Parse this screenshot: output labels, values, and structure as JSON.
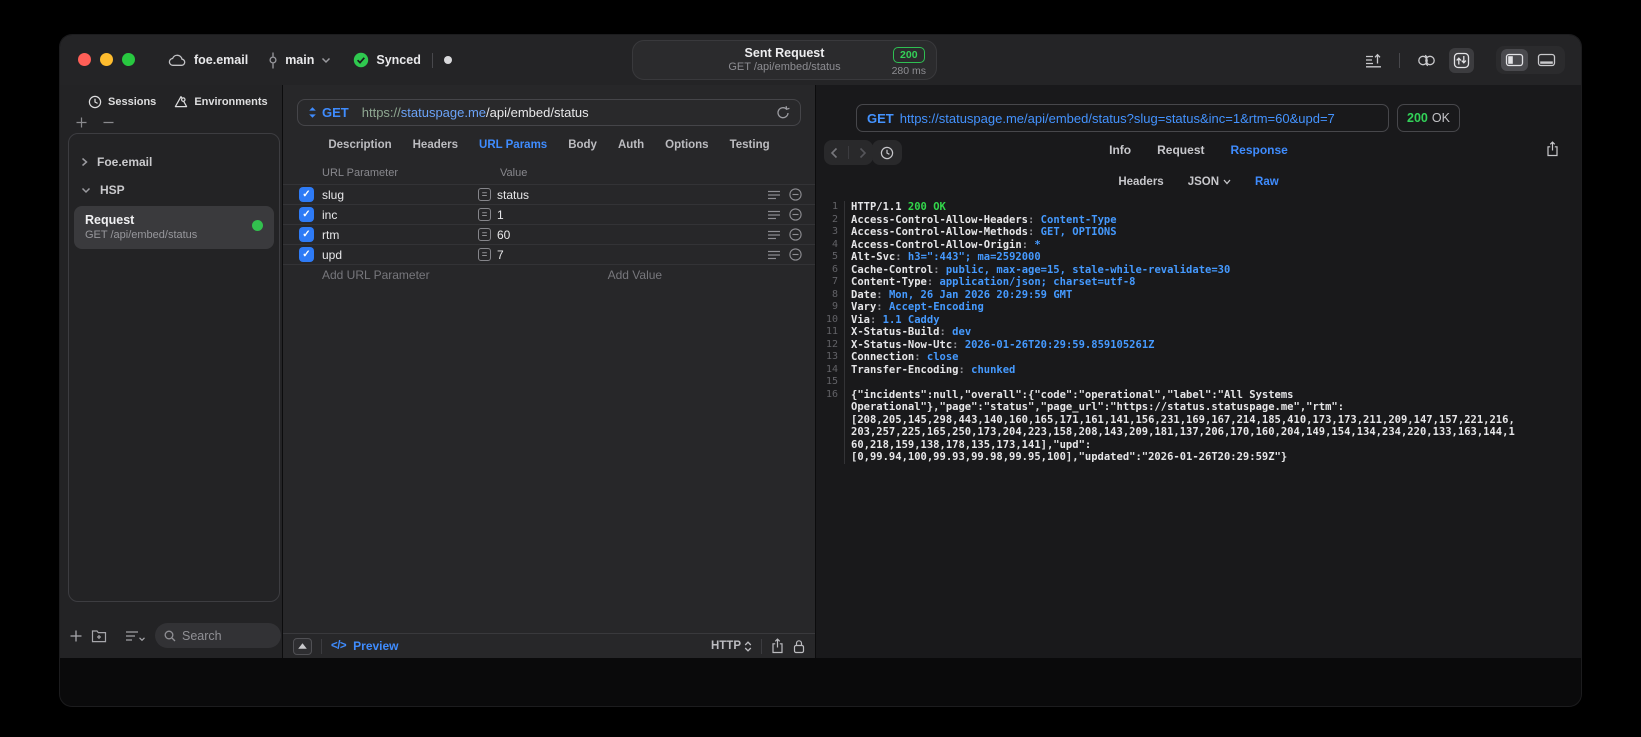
{
  "colors": {
    "accent_blue": "#3f8cfe",
    "status_green": "#32d158",
    "traffic_red": "#ff5f57",
    "traffic_yellow": "#febc2e",
    "traffic_green": "#28c840"
  },
  "titlebar": {
    "project": "foe.email",
    "branch": "main",
    "sync_status": "Synced",
    "center": {
      "title": "Sent Request",
      "subtitle": "GET /api/embed/status",
      "status_code": "200",
      "duration": "280 ms"
    }
  },
  "sidebar": {
    "tabs": [
      {
        "label": "Sessions"
      },
      {
        "label": "Environments"
      }
    ],
    "groups": [
      {
        "label": "Foe.email",
        "state": "collapsed"
      },
      {
        "label": "HSP",
        "state": "expanded"
      }
    ],
    "request": {
      "title": "Request",
      "subtitle": "GET /api/embed/status",
      "selected": true,
      "status_dot": "green"
    },
    "search_placeholder": "Search"
  },
  "request_editor": {
    "method": "GET",
    "url_scheme": "https://",
    "url_host": "statuspage.me",
    "url_path": "/api/embed/status",
    "tabs": [
      "Description",
      "Headers",
      "URL Params",
      "Body",
      "Auth",
      "Options",
      "Testing"
    ],
    "active_tab": "URL Params",
    "table": {
      "columns": [
        "URL Parameter",
        "Value"
      ],
      "rows": [
        {
          "enabled": true,
          "name": "slug",
          "value": "status"
        },
        {
          "enabled": true,
          "name": "inc",
          "value": "1"
        },
        {
          "enabled": true,
          "name": "rtm",
          "value": "60"
        },
        {
          "enabled": true,
          "name": "upd",
          "value": "7"
        }
      ],
      "add_name": "Add URL Parameter",
      "add_value": "Add Value"
    },
    "footer": {
      "code_glyph": "</>",
      "preview": "Preview",
      "protocol": "HTTP"
    }
  },
  "response_viewer": {
    "method": "GET",
    "url": "https://statuspage.me/api/embed/status?slug=status&inc=1&rtm=60&upd=7",
    "status_code": "200",
    "status_text": "OK",
    "tabs": [
      "Info",
      "Request",
      "Response"
    ],
    "active_tab": "Response",
    "subtabs": [
      "Headers",
      "JSON",
      "Raw"
    ],
    "active_subtab": "Raw",
    "code_lines": [
      {
        "n": "1",
        "seg": [
          [
            "w",
            "HTTP/1.1 "
          ],
          [
            "g",
            "200 OK"
          ]
        ]
      },
      {
        "n": "2",
        "seg": [
          [
            "k",
            "Access-Control-Allow-Headers"
          ],
          [
            "p",
            ": "
          ],
          [
            "v",
            "Content-Type"
          ]
        ]
      },
      {
        "n": "3",
        "seg": [
          [
            "k",
            "Access-Control-Allow-Methods"
          ],
          [
            "p",
            ": "
          ],
          [
            "v",
            "GET, OPTIONS"
          ]
        ]
      },
      {
        "n": "4",
        "seg": [
          [
            "k",
            "Access-Control-Allow-Origin"
          ],
          [
            "p",
            ": "
          ],
          [
            "v",
            "*"
          ]
        ]
      },
      {
        "n": "5",
        "seg": [
          [
            "k",
            "Alt-Svc"
          ],
          [
            "p",
            ": "
          ],
          [
            "v",
            "h3=\":443\"; ma=2592000"
          ]
        ]
      },
      {
        "n": "6",
        "seg": [
          [
            "k",
            "Cache-Control"
          ],
          [
            "p",
            ": "
          ],
          [
            "v",
            "public, max-age=15, stale-while-revalidate=30"
          ]
        ]
      },
      {
        "n": "7",
        "seg": [
          [
            "k",
            "Content-Type"
          ],
          [
            "p",
            ": "
          ],
          [
            "v",
            "application/json; charset=utf-8"
          ]
        ]
      },
      {
        "n": "8",
        "seg": [
          [
            "k",
            "Date"
          ],
          [
            "p",
            ": "
          ],
          [
            "v",
            "Mon, 26 Jan 2026 20:29:59 GMT"
          ]
        ]
      },
      {
        "n": "9",
        "seg": [
          [
            "k",
            "Vary"
          ],
          [
            "p",
            ": "
          ],
          [
            "v",
            "Accept-Encoding"
          ]
        ]
      },
      {
        "n": "10",
        "seg": [
          [
            "k",
            "Via"
          ],
          [
            "p",
            ": "
          ],
          [
            "v",
            "1.1 Caddy"
          ]
        ]
      },
      {
        "n": "11",
        "seg": [
          [
            "k",
            "X-Status-Build"
          ],
          [
            "p",
            ": "
          ],
          [
            "v",
            "dev"
          ]
        ]
      },
      {
        "n": "12",
        "seg": [
          [
            "k",
            "X-Status-Now-Utc"
          ],
          [
            "p",
            ": "
          ],
          [
            "v",
            "2026-01-26T20:29:59.859105261Z"
          ]
        ]
      },
      {
        "n": "13",
        "seg": [
          [
            "k",
            "Connection"
          ],
          [
            "p",
            ": "
          ],
          [
            "v",
            "close"
          ]
        ]
      },
      {
        "n": "14",
        "seg": [
          [
            "k",
            "Transfer-Encoding"
          ],
          [
            "p",
            ": "
          ],
          [
            "v",
            "chunked"
          ]
        ]
      },
      {
        "n": "15",
        "seg": []
      },
      {
        "n": "16",
        "seg": [
          [
            "w",
            "{\"incidents\":null,\"overall\":{\"code\":\"operational\",\"label\":\"All Systems"
          ]
        ]
      },
      {
        "n": "",
        "seg": [
          [
            "w",
            "Operational\"},\"page\":\"status\",\"page_url\":\"https://status.statuspage.me\",\"rtm\":"
          ]
        ]
      },
      {
        "n": "",
        "seg": [
          [
            "w",
            "[208,205,145,298,443,140,160,165,171,161,141,156,231,169,167,214,185,410,173,173,211,209,147,157,221,216,"
          ]
        ]
      },
      {
        "n": "",
        "seg": [
          [
            "w",
            "203,257,225,165,250,173,204,223,158,208,143,209,181,137,206,170,160,204,149,154,134,234,220,133,163,144,1"
          ]
        ]
      },
      {
        "n": "",
        "seg": [
          [
            "w",
            "60,218,159,138,178,135,173,141],\"upd\":"
          ]
        ]
      },
      {
        "n": "",
        "seg": [
          [
            "w",
            "[0,99.94,100,99.93,99.98,99.95,100],\"updated\":\"2026-01-26T20:29:59Z\"}"
          ]
        ]
      }
    ]
  }
}
